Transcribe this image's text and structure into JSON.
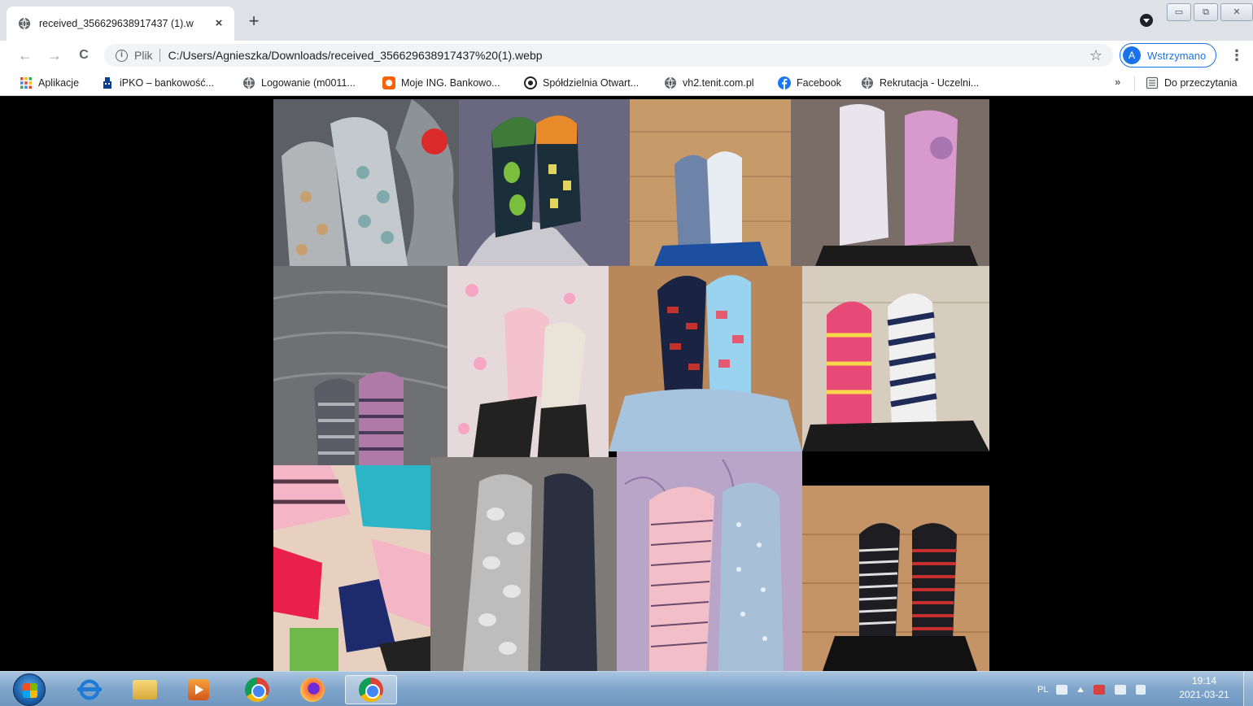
{
  "browser": {
    "tab": {
      "title": "received_356629638917437 (1).w",
      "close": "×"
    },
    "new_tab": "+",
    "toolbar": {
      "back": "←",
      "forward": "→",
      "reload": "C",
      "info": "i",
      "scheme_label": "Plik",
      "url": "C:/Users/Agnieszka/Downloads/received_356629638917437%20(1).webp",
      "star": "☆",
      "profile_initial": "A",
      "profile_label": "Wstrzymano",
      "menu": "⋮"
    },
    "window_buttons": {
      "minimize": "▭",
      "maximize": "⧉",
      "close": "✕"
    },
    "bookmarks": [
      {
        "label": "Aplikacje",
        "icon": "apps-grid-icon"
      },
      {
        "label": "iPKO – bankowość...",
        "icon": "pko-icon"
      },
      {
        "label": "Logowanie (m0011...",
        "icon": "globe-icon"
      },
      {
        "label": "Moje ING. Bankowo...",
        "icon": "ing-icon"
      },
      {
        "label": "Spółdzielnia Otwart...",
        "icon": "coop-icon"
      },
      {
        "label": "vh2.tenit.com.pl",
        "icon": "globe-icon"
      },
      {
        "label": "Facebook",
        "icon": "facebook-icon"
      },
      {
        "label": "Rekrutacja - Uczelni...",
        "icon": "globe-icon"
      }
    ],
    "bookmarks_more": "»",
    "reading_list": "Do przeczytania"
  },
  "image": {
    "content": "collage of socks photos",
    "tiles": [
      {
        "name": "photo-grey-cartoon-socks",
        "palette": [
          "#8a8f93",
          "#a9b3b9",
          "#c8b08a",
          "#da2a2a"
        ]
      },
      {
        "name": "photo-avocado-socks",
        "palette": [
          "#6a6780",
          "#1a2f3a",
          "#7cbf3e",
          "#e8892a"
        ]
      },
      {
        "name": "photo-blue-white-socks",
        "palette": [
          "#c79a6a",
          "#6d84a8",
          "#e8ecf3",
          "#1d4fa0"
        ]
      },
      {
        "name": "photo-white-pink-socks",
        "palette": [
          "#7a6c66",
          "#e8e6ec",
          "#d89acd",
          "#1b1b1b"
        ]
      },
      {
        "name": "photo-grey-stripe-socks",
        "palette": [
          "#6f7073",
          "#9a9b9e",
          "#5a5d66",
          "#b07aa8"
        ]
      },
      {
        "name": "photo-pink-face-socks",
        "palette": [
          "#e6d9dc",
          "#f6a6c4",
          "#eae3d8",
          "#222"
        ]
      },
      {
        "name": "photo-dog-pattern-socks",
        "palette": [
          "#b8875a",
          "#1a2442",
          "#9ad3f0",
          "#c3312b"
        ]
      },
      {
        "name": "photo-rainbow-stripe-socks",
        "palette": [
          "#d6cdbf",
          "#e84a78",
          "#1f2c57",
          "#f0f0f0"
        ]
      },
      {
        "name": "photo-many-colourful-socks",
        "palette": [
          "#e8d0c0",
          "#2bb5c6",
          "#e8204a",
          "#f4b6c6"
        ]
      },
      {
        "name": "photo-grey-navy-socks",
        "palette": [
          "#7e7a78",
          "#bdbdbd",
          "#2a3040",
          "#e5e5e5"
        ]
      },
      {
        "name": "photo-pink-blue-dot-socks",
        "palette": [
          "#b9a5c8",
          "#f2bfc8",
          "#a7c0d8",
          "#6b4b6d"
        ]
      },
      {
        "name": "photo-black-red-stripe-socks",
        "palette": [
          "#c49466",
          "#1e1e22",
          "#e0e0e0",
          "#c83030"
        ]
      }
    ]
  },
  "taskbar": {
    "apps": [
      {
        "name": "internet-explorer",
        "active": false
      },
      {
        "name": "file-explorer",
        "active": false
      },
      {
        "name": "media-player",
        "active": false
      },
      {
        "name": "chrome",
        "active": false
      },
      {
        "name": "firefox",
        "active": false
      },
      {
        "name": "chrome-window",
        "active": true
      }
    ],
    "language": "PL",
    "time": "19:14",
    "date": "2021-03-21"
  }
}
